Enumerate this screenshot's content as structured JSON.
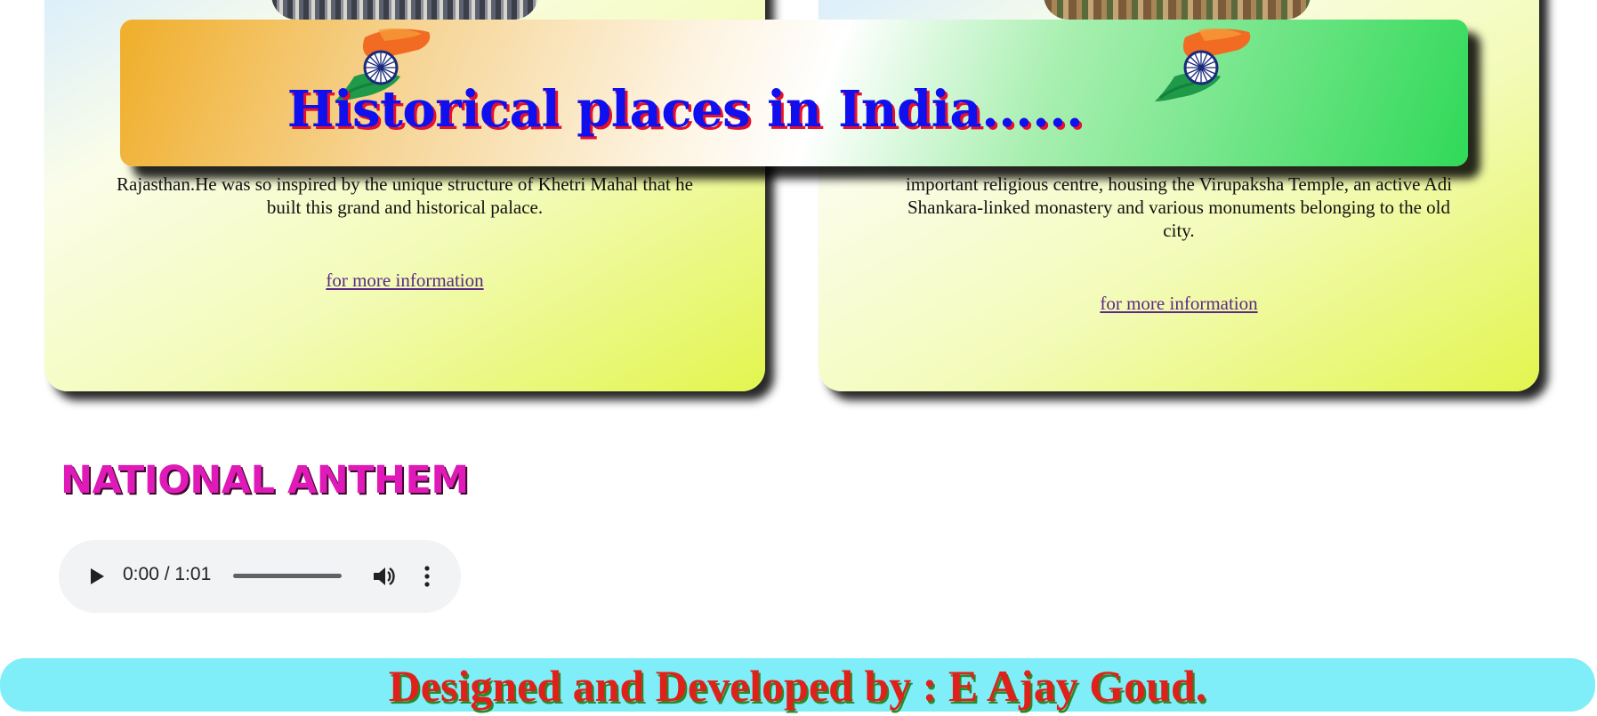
{
  "header": {
    "title": "Historical places in India......",
    "flag_icon": "india-flag-chakra-icon"
  },
  "cards": [
    {
      "text": "Rajasthan.He was so inspired by the unique structure of Khetri Mahal that he built this grand and historical palace.",
      "link_label": "for more information"
    },
    {
      "text": "important religious centre, housing the Virupaksha Temple, an active Adi Shankara-linked monastery and various monuments belonging to the old city.",
      "link_label": "for more information"
    }
  ],
  "anthem": {
    "title": "NATIONAL ANTHEM",
    "player": {
      "time": "0:00 / 1:01",
      "progress": 0,
      "play_icon": "play-icon",
      "volume_icon": "volume-icon",
      "more_icon": "more-options-icon"
    }
  },
  "footer": {
    "text": "Designed and Developed by : E Ajay Goud."
  },
  "colors": {
    "banner_title": "#1010ee",
    "banner_title_shadow": "#e8102a",
    "anthem_title": "#e01ab8",
    "footer_bg": "#80eef8",
    "footer_text": "#e0201a",
    "link": "#5a2a86"
  }
}
